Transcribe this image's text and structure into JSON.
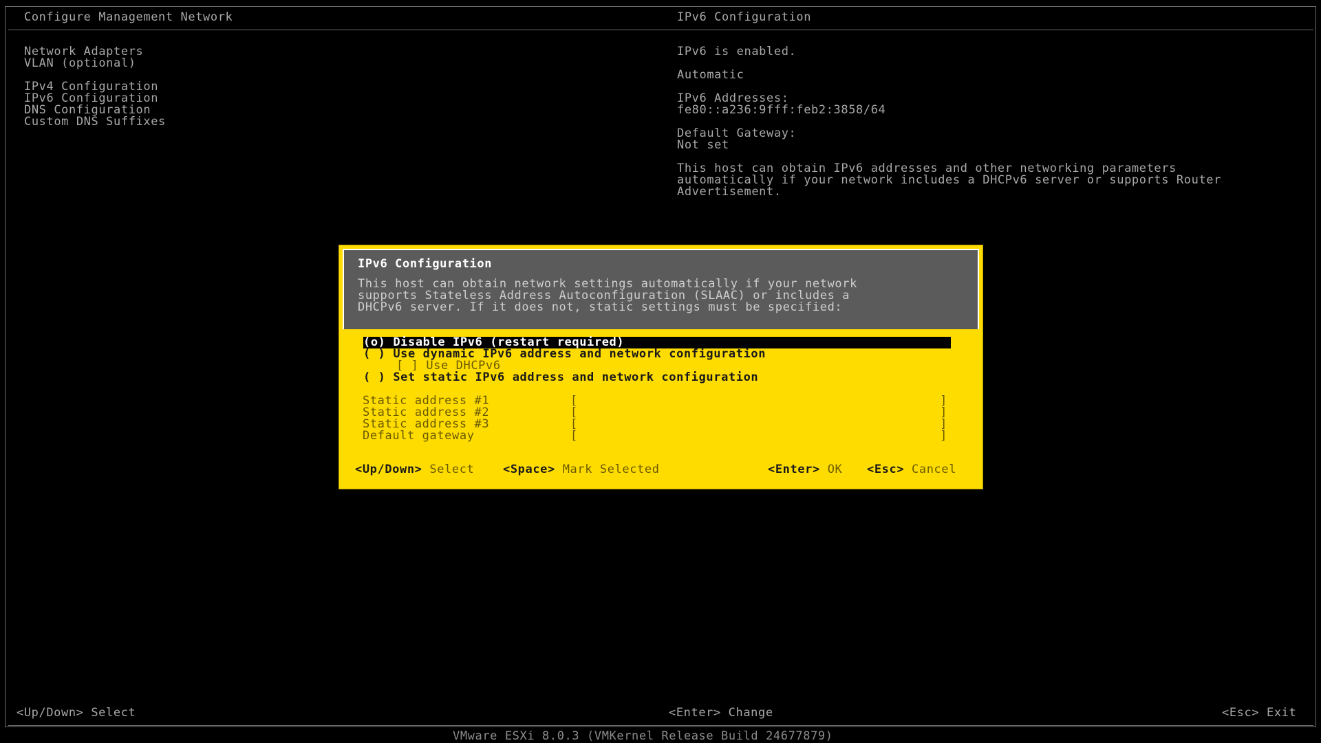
{
  "left_panel": {
    "title": "Configure Management Network",
    "menu_group_1": [
      "Network Adapters",
      "VLAN (optional)"
    ],
    "menu_group_2": [
      "IPv4 Configuration",
      "IPv6 Configuration",
      "DNS Configuration",
      "Custom DNS Suffixes"
    ]
  },
  "right_panel": {
    "title": "IPv6 Configuration",
    "status": "IPv6 is enabled.",
    "mode": "Automatic",
    "addresses_label": "IPv6 Addresses:",
    "address": "fe80::a236:9fff:feb2:3858/64",
    "gateway_label": "Default Gateway:",
    "gateway_value": "Not set",
    "description": "This host can obtain IPv6 addresses and other networking parameters\nautomatically if your network includes a DHCPv6 server or supports Router\nAdvertisement."
  },
  "dialog": {
    "title": "IPv6 Configuration",
    "description": "This host can obtain network settings automatically if your network\nsupports Stateless Address Autoconfiguration (SLAAC) or includes a\nDHCPv6 server. If it does not, static settings must be specified:",
    "options": [
      "(o) Disable IPv6 (restart required)",
      "( ) Use dynamic IPv6 address and network configuration",
      "[ ] Use DHCPv6",
      "( ) Set static IPv6 address and network configuration"
    ],
    "fields": [
      {
        "label": "Static address #1",
        "value": ""
      },
      {
        "label": "Static address #2",
        "value": ""
      },
      {
        "label": "Static address #3",
        "value": ""
      },
      {
        "label": "Default gateway",
        "value": ""
      }
    ],
    "footer": {
      "updown_key": "<Up/Down>",
      "updown_action": "Select",
      "space_key": "<Space>",
      "space_action": "Mark Selected",
      "enter_key": "<Enter>",
      "enter_action": "OK",
      "esc_key": "<Esc>",
      "esc_action": "Cancel"
    }
  },
  "bottom_bar": {
    "select": "<Up/Down> Select",
    "change": "<Enter> Change",
    "exit": "<Esc> Exit"
  },
  "version": "VMware ESXi 8.0.3 (VMKernel Release Build 24677879)",
  "colors": {
    "background": "#000000",
    "dialog": "#ffdc00",
    "dialog_header": "#5b5b5b",
    "text": "#a8a8a8"
  }
}
